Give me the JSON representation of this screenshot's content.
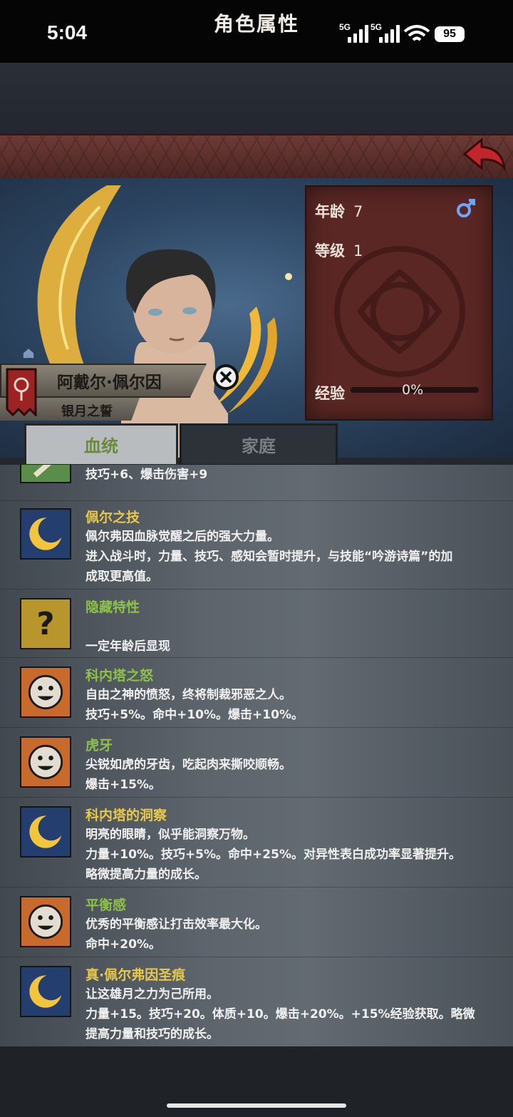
{
  "status": {
    "time": "5:04",
    "sig1": "5G",
    "sig2": "5G",
    "battery": "95"
  },
  "header": {
    "title": "角色属性"
  },
  "character": {
    "name": "阿戴尔·佩尔因",
    "title": "银月之誓",
    "age_label": "年龄",
    "age": "7",
    "level_label": "等级",
    "level": "1",
    "exp_label": "经验",
    "exp_percent": "0%",
    "exp_fraction": 0
  },
  "tabs": {
    "lineage": "血统",
    "family": "家庭"
  },
  "traits": [
    {
      "name": "",
      "lines": [
        "技巧+6、爆击伤害+9"
      ]
    },
    {
      "name": "佩尔之技",
      "lines": [
        "佩尔弗因血脉觉醒之后的强大力量。",
        "进入战斗时，力量、技巧、感知会暂时提升，与技能“吟游诗篇”的加",
        "成取更高值。"
      ]
    },
    {
      "name": "隐藏特性",
      "lines": [
        "",
        "一定年龄后显现"
      ]
    },
    {
      "name": "科内塔之怒",
      "lines": [
        "自由之神的愤怒，终将制裁邪恶之人。",
        "技巧+5%。命中+10%。爆击+10%。"
      ]
    },
    {
      "name": "虎牙",
      "lines": [
        "尖锐如虎的牙齿，吃起肉来撕咬顺畅。",
        "爆击+15%。"
      ]
    },
    {
      "name": "科内塔的洞察",
      "lines": [
        "明亮的眼睛，似乎能洞察万物。",
        "力量+10%。技巧+5%。命中+25%。对异性表白成功率显著提升。",
        "略微提高力量的成长。"
      ]
    },
    {
      "name": "平衡感",
      "lines": [
        "优秀的平衡感让打击效率最大化。",
        "命中+20%。"
      ]
    },
    {
      "name": "真·佩尔弗因圣痕",
      "lines": [
        "让这雄月之力为己所用。",
        "力量+15。技巧+20。体质+10。爆击+20%。+15%经验获取。略微",
        "提高力量和技巧的成长。"
      ]
    }
  ],
  "colors": {
    "trait_green": "#8dc14a",
    "trait_yellow": "#e8c84a",
    "title_bar": "#5a2d2a",
    "gender": "#6aa6ff"
  }
}
